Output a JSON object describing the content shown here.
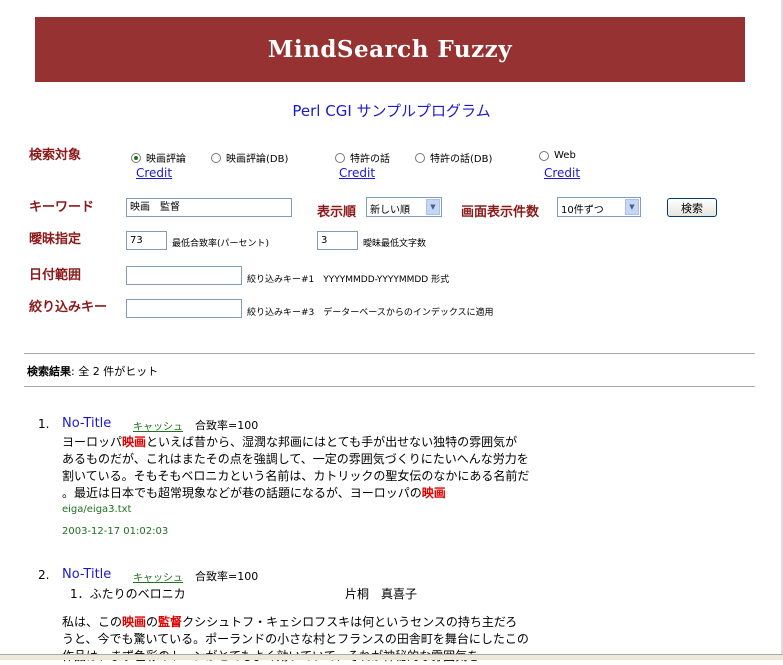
{
  "banner": {
    "title": "MindSearch Fuzzy"
  },
  "subtitle": "Perl CGI サンプルプログラム",
  "labels": {
    "target": "検索対象",
    "keyword": "キーワード",
    "sort": "表示順",
    "perpage": "画面表示件数",
    "fuzzy": "曖昧指定",
    "date_range": "日付範囲",
    "filter_key": "絞り込みキー"
  },
  "targets": [
    {
      "label": "映画評論",
      "checked": true
    },
    {
      "label": "映画評論(DB)",
      "checked": false
    },
    {
      "label": "特許の話",
      "checked": false
    },
    {
      "label": "特許の話(DB)",
      "checked": false
    },
    {
      "label": "Web",
      "checked": false
    }
  ],
  "credit_label": "Credit",
  "keyword_value": "映画　監督",
  "sort_value": "新しい順",
  "perpage_value": "10件ずつ",
  "search_button": "検索",
  "fuzzy": {
    "rate_value": "73",
    "rate_note": "最低合致率(パーセント)",
    "chars_value": "3",
    "chars_note": "曖昧最低文字数"
  },
  "date_note": "絞り込みキー#1　YYYYMMDD-YYYYMMDD 形式",
  "filter_note": "絞り込みキー#3　データーベースからのインデックスに適用",
  "results_summary": {
    "label": "検索結果",
    "text": ": 全 2 件がヒット"
  },
  "results": [
    {
      "num": "1.",
      "title": "No-Title",
      "cache": "キャッシュ",
      "score": "合致率=100",
      "lines": [
        [
          " ヨーロッパ",
          "映画",
          "といえば昔から、湿潤な邦画にはとても手が出せない独特の雰囲気が"
        ],
        [
          "あるものだが、これはまたその点を強調して、一定の雰囲気づくりにたいへんな労力を"
        ],
        [
          "割いている。そもそもベロニカという名前は、カトリックの聖女伝のなかにある名前だ"
        ],
        [
          "。最近は日本でも超常現象などが巷の話題になるが、ヨーロッパの",
          "映画",
          ""
        ]
      ],
      "path": "eiga/eiga3.txt",
      "date": "2003-12-17 01:02:03"
    },
    {
      "num": "2.",
      "title": "No-Title",
      "cache": "キャッシュ",
      "score": "合致率=100",
      "sub_left": "1．ふたりのベロニカ",
      "sub_right": "片桐　真喜子",
      "lines": [
        [
          " 私は、この",
          "映画",
          "の",
          "監督",
          "クシシュトフ・キェシロフスキは何というセンスの持ち主だろ"
        ],
        [
          "うと、今でも驚いている。ポーランドの小さな村とフランスの田舎町を舞台にしたこの"
        ],
        [
          "作品は、まず色彩のトーンがとてもよく効いていて、それが神秘的な雰囲気を"
        ]
      ]
    }
  ]
}
